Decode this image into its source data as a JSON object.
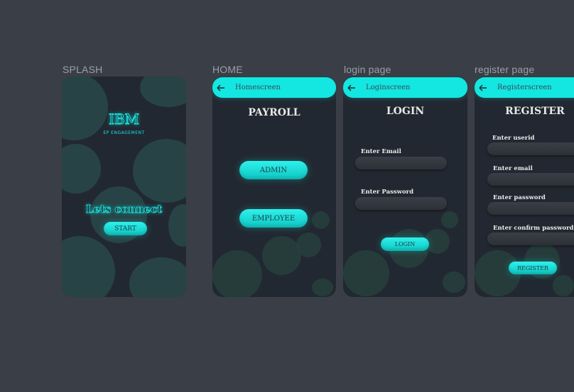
{
  "frames": {
    "splash": {
      "label": "SPLASH",
      "logo": "IBM",
      "logo_sub": "EP ENGAGEMENT",
      "headline": "Lets connect",
      "start_button": "START"
    },
    "home": {
      "label": "HOME",
      "appbar_title": "Homescreen",
      "title": "PAYROLL",
      "admin_button": "ADMIN",
      "employee_button": "EMPLOYEE"
    },
    "login": {
      "label": "login page",
      "appbar_title": "Loginscreen",
      "title": "LOGIN",
      "email_label": "Enter  Email",
      "password_label": "Enter  Password",
      "login_button": "LOGIN"
    },
    "register": {
      "label": "register page",
      "appbar_title": "Registerscreen",
      "title": "REGISTER",
      "userid_label": "Enter userid",
      "email_label": "Enter  email",
      "password_label": "Enter  password",
      "confirm_label": "Enter  confirm password",
      "register_button": "REGISTER"
    }
  },
  "colors": {
    "background": "#393e47",
    "phone": "#222831",
    "accent": "#14e6e1"
  },
  "icons": {
    "back": "arrow-left-icon"
  }
}
